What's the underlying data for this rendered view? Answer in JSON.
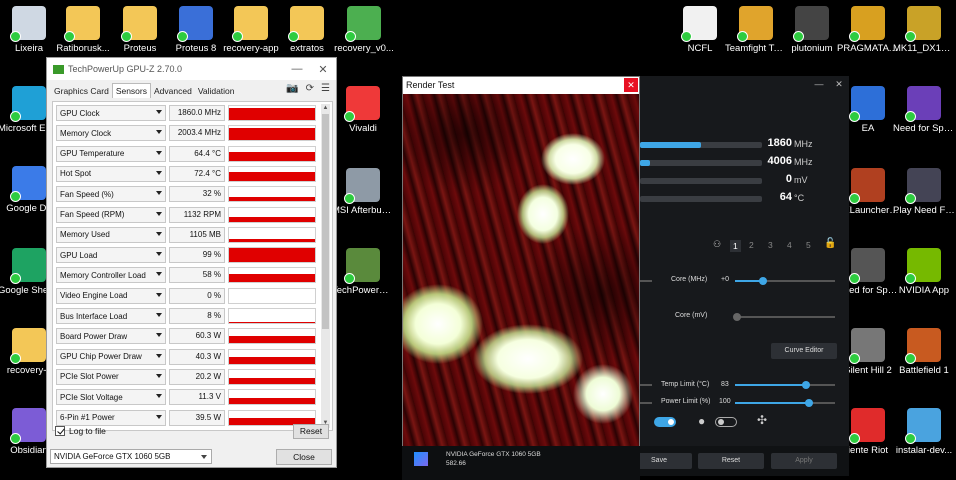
{
  "desktop": {
    "left_icons": [
      {
        "name": "recycle-bin-icon",
        "label": "Lixeira",
        "color": "#cfd8e3"
      },
      {
        "name": "microsoft-edge-icon",
        "label": "Microsoft Edge",
        "color": "#1fa0d6"
      },
      {
        "name": "google-docs-icon",
        "label": "Google Do",
        "color": "#3b7be8"
      },
      {
        "name": "google-sheets-icon",
        "label": "Google Sheets",
        "color": "#1ea362"
      },
      {
        "name": "folder-icon",
        "label": "recovery-c",
        "color": "#f3c757"
      },
      {
        "name": "obsidian-icon",
        "label": "Obsidian",
        "color": "#7c5cd6"
      }
    ],
    "top_icons": [
      {
        "name": "folder-icon",
        "label": "Ratiborusk...",
        "color": "#f3c757"
      },
      {
        "name": "folder-icon",
        "label": "Proteus",
        "color": "#f3c757"
      },
      {
        "name": "proteus8-icon",
        "label": "Proteus 8",
        "color": "#3a6fd8"
      },
      {
        "name": "folder-icon",
        "label": "recovery-app",
        "color": "#f3c757"
      },
      {
        "name": "folder-icon",
        "label": "extratos",
        "color": "#f3c757"
      },
      {
        "name": "bluestacks-icon",
        "label": "recovery_v0...",
        "color": "#4caf50"
      }
    ],
    "middle_icons": [
      {
        "name": "vivaldi-icon",
        "label": "Vivaldi",
        "color": "#ef3939"
      },
      {
        "name": "msi-afterburner-icon",
        "label": "MSI Afterburner",
        "color": "#8e9aa6"
      },
      {
        "name": "gpu-z-icon",
        "label": "TechPowerUp GPU-Z",
        "color": "#5a8a3c"
      }
    ],
    "right_top_icons": [
      {
        "name": "document-icon",
        "label": "NCFL",
        "color": "#f1f1f1"
      },
      {
        "name": "teamfight-tactics-icon",
        "label": "Teamfight Tactics",
        "color": "#e0a42c"
      },
      {
        "name": "plutonium-icon",
        "label": "plutonium",
        "color": "#444"
      },
      {
        "name": "pragmata-icon",
        "label": "PRAGMATA [HV]",
        "color": "#d8a020"
      },
      {
        "name": "mk11-icon",
        "label": "MK11_DX12 - Atalho",
        "color": "#c9a227"
      }
    ],
    "right_col1_icons": [
      {
        "name": "ea-icon",
        "label": "EA",
        "color": "#2d6fd8"
      },
      {
        "name": "xlauncher-icon",
        "label": "EXLauncher - Atalho",
        "color": "#b04020"
      },
      {
        "name": "nfs-speed-icon",
        "label": "Need for Speed™",
        "color": "#555"
      },
      {
        "name": "silent-hill-icon",
        "label": "Silent Hill 2",
        "color": "#777"
      },
      {
        "name": "riot-client-icon",
        "label": "iente Riot",
        "color": "#e02b2b"
      }
    ],
    "right_col2_icons": [
      {
        "name": "nfs-heat-icon",
        "label": "Need for Speed™ Heat",
        "color": "#6b3fb8"
      },
      {
        "name": "nfs-mw-icon",
        "label": "Play Need For Speed™...",
        "color": "#445"
      },
      {
        "name": "nvidia-app-icon",
        "label": "NVIDIA App",
        "color": "#76b900"
      },
      {
        "name": "battlefield-icon",
        "label": "Battlefield 1",
        "color": "#c85a20"
      },
      {
        "name": "installer-icon",
        "label": "instalar-dev...",
        "color": "#4aa3df"
      }
    ]
  },
  "gpuz": {
    "title": "TechPowerUp GPU-Z 2.70.0",
    "tabs": [
      "Graphics Card",
      "Sensors",
      "Advanced",
      "Validation"
    ],
    "active_tab": "Sensors",
    "sensors": [
      {
        "name": "GPU Clock",
        "value": "1860.0 MHz",
        "level": 0.85
      },
      {
        "name": "Memory Clock",
        "value": "2003.4 MHz",
        "level": 0.85
      },
      {
        "name": "GPU Temperature",
        "value": "64.4 °C",
        "level": 0.6
      },
      {
        "name": "Hot Spot",
        "value": "72.4 °C",
        "level": 0.65
      },
      {
        "name": "Fan Speed (%)",
        "value": "32 %",
        "level": 0.32
      },
      {
        "name": "Fan Speed (RPM)",
        "value": "1132 RPM",
        "level": 0.3
      },
      {
        "name": "Memory Used",
        "value": "1105 MB",
        "level": 0.2
      },
      {
        "name": "GPU Load",
        "value": "99 %",
        "level": 0.99
      },
      {
        "name": "Memory Controller Load",
        "value": "58 %",
        "level": 0.58
      },
      {
        "name": "Video Engine Load",
        "value": "0 %",
        "level": 0.0
      },
      {
        "name": "Bus Interface Load",
        "value": "8 %",
        "level": 0.08
      },
      {
        "name": "Board Power Draw",
        "value": "60.3 W",
        "level": 0.5
      },
      {
        "name": "GPU Chip Power Draw",
        "value": "40.3 W",
        "level": 0.45
      },
      {
        "name": "PCIe Slot Power",
        "value": "20.2 W",
        "level": 0.45
      },
      {
        "name": "PCIe Slot Voltage",
        "value": "11.3 V",
        "level": 0.45
      },
      {
        "name": "6-Pin #1 Power",
        "value": "39.5 W",
        "level": 0.5
      }
    ],
    "log_to_file_label": "Log to file",
    "log_to_file_checked": true,
    "reset_label": "Reset",
    "gpu_select": "NVIDIA GeForce GTX 1060 5GB",
    "close_label": "Close",
    "graph_color": "#e00000"
  },
  "render_test": {
    "title": "Render Test",
    "close_glyph": "✕"
  },
  "afterburner": {
    "monitors": [
      {
        "value": "1860",
        "unit": "MHz",
        "level": 0.5
      },
      {
        "value": "4006",
        "unit": "MHz",
        "level": 0.08
      },
      {
        "value": "0",
        "unit": "mV",
        "level": 0.0
      },
      {
        "value": "64",
        "unit": "°C",
        "level": 0.0
      }
    ],
    "profiles": [
      "1",
      "2",
      "3",
      "4",
      "5"
    ],
    "active_profile": "1",
    "core_mhz_label": "Core (MHz)",
    "core_mhz_value": "+0",
    "core_mv_label": "Core (mV)",
    "curve_editor_label": "Curve Editor",
    "temp_limit_label": "Temp Limit (°C)",
    "temp_limit_value": "83",
    "power_limit_label": "Power Limit (%)",
    "power_limit_value": "100",
    "save_label": "Save",
    "reset_label": "Reset",
    "apply_label": "Apply",
    "gpu_name": "NVIDIA GeForce GTX 1060 5GB",
    "driver_version": "582.66",
    "accent": "#3ea6e6"
  }
}
